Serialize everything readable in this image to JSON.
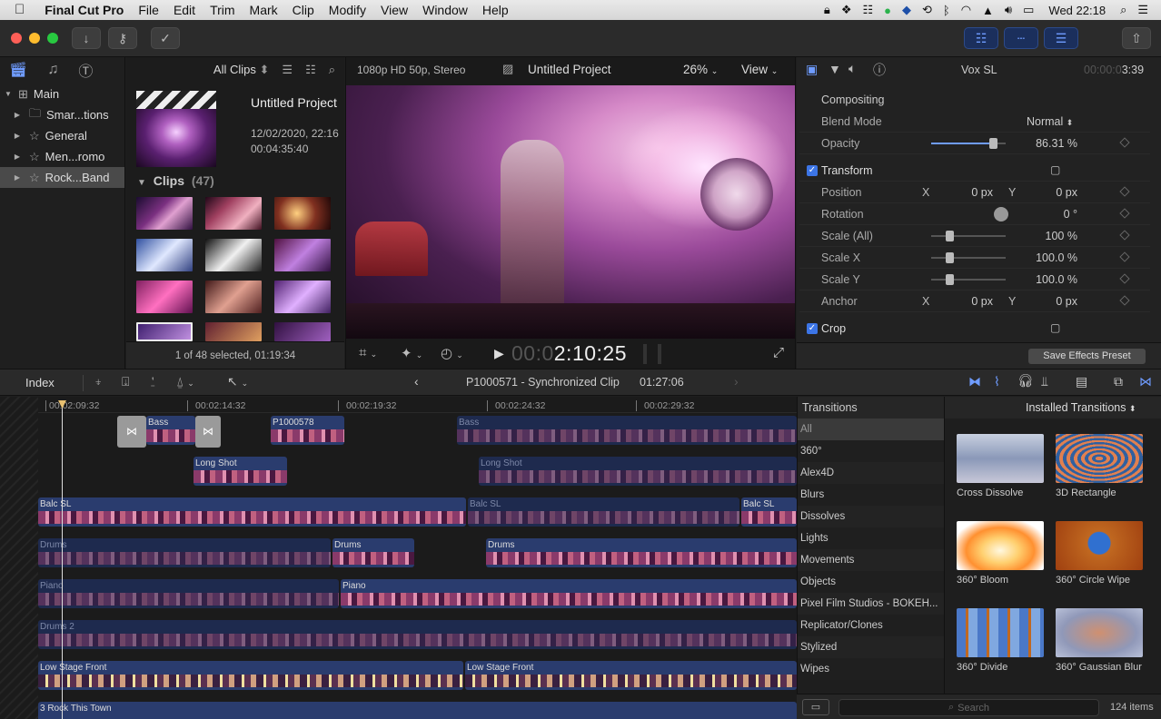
{
  "menubar": {
    "app_name": "Final Cut Pro",
    "menus": [
      "File",
      "Edit",
      "Trim",
      "Mark",
      "Clip",
      "Modify",
      "View",
      "Window",
      "Help"
    ],
    "clock": "Wed 22:18"
  },
  "browser": {
    "filter_label": "All Clips",
    "library": [
      {
        "label": "Main",
        "level": 0,
        "expanded": true,
        "icon": "grid-icon"
      },
      {
        "label": "Smar...tions",
        "level": 1,
        "icon": "folder-icon"
      },
      {
        "label": "General",
        "level": 1,
        "icon": "star-event-icon"
      },
      {
        "label": "Men...romo",
        "level": 1,
        "icon": "star-event-icon"
      },
      {
        "label": "Rock...Band",
        "level": 1,
        "icon": "star-event-icon",
        "selected": true
      }
    ],
    "project": {
      "name": "Untitled Project",
      "date": "12/02/2020, 22:16",
      "duration": "00:04:35:40"
    },
    "clips_header": "Clips",
    "clips_count": "(47)",
    "status": "1 of 48 selected, 01:19:34"
  },
  "viewer": {
    "format": "1080p HD 50p, Stereo",
    "project_name": "Untitled Project",
    "zoom": "26%",
    "view_label": "View",
    "timecode_dim": "00:0",
    "timecode_bright": "2:10:25"
  },
  "inspector": {
    "clip_name": "Vox SL",
    "duration_dim": "00:00:0",
    "duration_bright": "3:39",
    "compositing": "Compositing",
    "blend_mode_label": "Blend Mode",
    "blend_mode_value": "Normal",
    "opacity_label": "Opacity",
    "opacity_value": "86.31",
    "opacity_level": 0.8631,
    "transform_label": "Transform",
    "position_label": "Position",
    "position_x": "0",
    "position_y": "0",
    "rotation_label": "Rotation",
    "rotation_value": "0",
    "scale_all_label": "Scale (All)",
    "scale_all_value": "100",
    "scale_x_label": "Scale X",
    "scale_x_value": "100.0",
    "scale_y_label": "Scale Y",
    "scale_y_value": "100.0",
    "anchor_label": "Anchor",
    "anchor_x": "0",
    "anchor_y": "0",
    "crop_label": "Crop",
    "x_label": "X",
    "y_label": "Y",
    "px_unit": "px",
    "pct_unit": "%",
    "deg_unit": "°",
    "save_preset": "Save Effects Preset"
  },
  "timeline": {
    "index_label": "Index",
    "clip_title": "P1000571 - Synchronized Clip",
    "clip_duration": "01:27:06",
    "ruler": [
      "00:02:09:32",
      "00:02:14:32",
      "00:02:19:32",
      "00:02:24:32",
      "00:02:29:32"
    ],
    "clips": {
      "bass1": "Bass",
      "p1000578": "P1000578",
      "bass2": "Bass",
      "long1": "Long Shot",
      "long2": "Long Shot",
      "balc1": "Balc SL",
      "balc2": "Balc SL",
      "balc3": "Balc SL",
      "drums1": "Drums",
      "drums2": "Drums",
      "drums3": "Drums",
      "piano1": "Piano",
      "piano2": "Piano",
      "drums_2": "Drums 2",
      "low1": "Low Stage Front",
      "low2": "Low Stage Front",
      "rock": "3 Rock This Town"
    }
  },
  "transitions": {
    "title": "Transitions",
    "installed": "Installed Transitions",
    "categories": [
      "All",
      "360°",
      "Alex4D",
      "Blurs",
      "Dissolves",
      "Lights",
      "Movements",
      "Objects",
      "Pixel Film Studios - BOKEH...",
      "Replicator/Clones",
      "Stylized",
      "Wipes"
    ],
    "items": [
      {
        "name": "Cross Dissolve",
        "icon": "cross-dissolve-thumbnail"
      },
      {
        "name": "3D Rectangle",
        "icon": "3d-rectangle-thumbnail"
      },
      {
        "name": "360° Bloom",
        "icon": "bloom-thumbnail"
      },
      {
        "name": "360° Circle Wipe",
        "icon": "circle-wipe-thumbnail"
      },
      {
        "name": "360° Divide",
        "icon": "divide-thumbnail"
      },
      {
        "name": "360° Gaussian Blur",
        "icon": "gaussian-blur-thumbnail"
      }
    ],
    "search_placeholder": "Search",
    "count": "124 items"
  }
}
